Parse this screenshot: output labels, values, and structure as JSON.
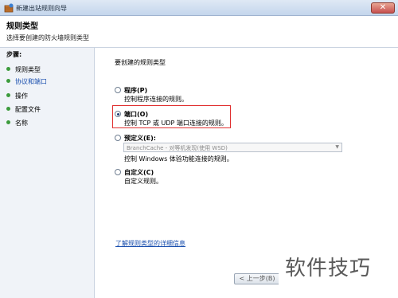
{
  "window": {
    "title": "新建出站规则向导",
    "close_symbol": "✕"
  },
  "header": {
    "title": "规则类型",
    "subtitle": "选择要创建的防火墙规则类型"
  },
  "sidebar": {
    "title": "步骤:",
    "steps": [
      {
        "label": "规则类型"
      },
      {
        "label": "协议和端口"
      },
      {
        "label": "操作"
      },
      {
        "label": "配置文件"
      },
      {
        "label": "名称"
      }
    ]
  },
  "main": {
    "prompt": "要创建的规则类型",
    "options": [
      {
        "title": "程序(P)",
        "description": "控制程序连接的规则。",
        "selected": false
      },
      {
        "title": "端口(O)",
        "description": "控制 TCP 或 UDP 端口连接的规则。",
        "selected": true
      },
      {
        "title": "预定义(E):",
        "description": "控制 Windows 体验功能连接的规则。",
        "selected": false
      },
      {
        "title": "自定义(C)",
        "description": "自定义规则。",
        "selected": false
      }
    ],
    "predefined_select": {
      "value": "BranchCache - 对等机发现(使用 WSD)"
    },
    "learn_more_link": "了解规则类型的详细信息",
    "back_button": "< 上一步(B)"
  },
  "watermark": "软件技巧",
  "colors": {
    "highlight": "#e03030",
    "link": "#1a4fae",
    "bullet": "#3c9b3c"
  }
}
